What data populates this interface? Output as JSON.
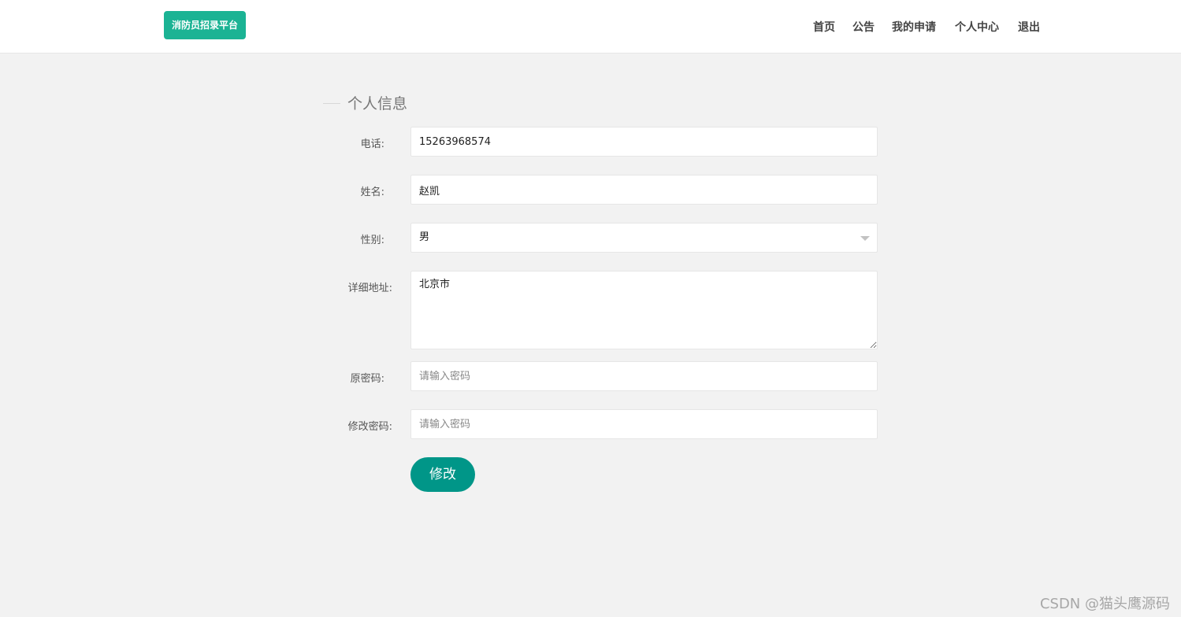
{
  "header": {
    "logo": "消防员招录平台",
    "nav": [
      "首页",
      "公告",
      "我的申请",
      "个人中心",
      "退出"
    ]
  },
  "section": {
    "title": "个人信息"
  },
  "form": {
    "phone_label": "电话:",
    "phone_value": "15263968574",
    "name_label": "姓名:",
    "name_value": "赵凯",
    "gender_label": "性别:",
    "gender_value": "男",
    "address_label": "详细地址:",
    "address_value": "北京市",
    "old_password_label": "原密码:",
    "old_password_placeholder": "请输入密码",
    "new_password_label": "修改密码:",
    "new_password_placeholder": "请输入密码",
    "submit_label": "修改"
  },
  "watermark": "CSDN @猫头鹰源码",
  "colors": {
    "brand": "#1bb394",
    "button": "#009688",
    "background": "#f2f2f2"
  }
}
